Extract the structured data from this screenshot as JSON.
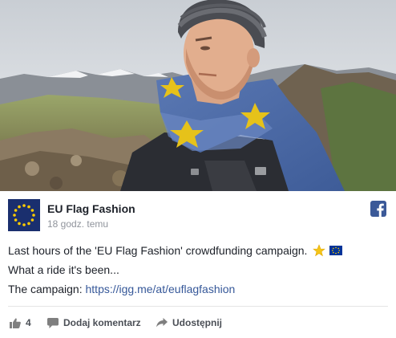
{
  "post": {
    "page_name": "EU Flag Fashion",
    "timestamp": "18 godz. temu",
    "lines": [
      "Last hours of the 'EU Flag Fashion' crowdfunding campaign.",
      "What a ride it's been...",
      "The campaign: "
    ],
    "link_text": "https://igg.me/at/euflagfashion",
    "icons": [
      "star-emoji",
      "eu-flag-emoji"
    ]
  },
  "actions": {
    "like_count": "4",
    "comment_label": "Dodaj komentarz",
    "share_label": "Udostępnij"
  },
  "colors": {
    "facebook_blue": "#3b5998",
    "link": "#365899",
    "eu_blue": "#003399",
    "eu_yellow": "#ffcc00"
  }
}
